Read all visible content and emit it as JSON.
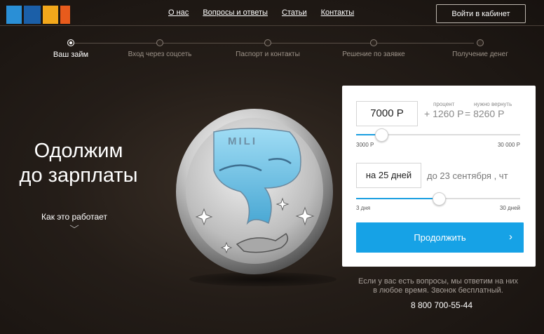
{
  "logo": {
    "text": "MILI",
    "colors": [
      "#2a8fd6",
      "#1b5fa8",
      "#f2a71b",
      "#e85b1c"
    ]
  },
  "nav": {
    "items": [
      "О нас",
      "Вопросы и ответы",
      "Статьи",
      "Контакты"
    ]
  },
  "login": {
    "label": "Войти   в кабинет"
  },
  "steps": [
    {
      "label": "Ваш займ",
      "active": true
    },
    {
      "label": "Вход  через  соцсеть",
      "active": false
    },
    {
      "label": "Паспорт  и контакты",
      "active": false
    },
    {
      "label": "Решение   по заявке",
      "active": false
    },
    {
      "label": "Получение   денег",
      "active": false
    }
  ],
  "hero": {
    "line1": "Одолжим",
    "line2": "до зарплаты"
  },
  "how_it_works": {
    "label": "Как это работает",
    "icon": "chevron-down-icon"
  },
  "coin": {
    "text": "MILI"
  },
  "calculator": {
    "amount": "7000  Р",
    "percent_label": "процент",
    "return_label": "нужно  вернуть",
    "percent_value": "+ 1260   Р",
    "return_value": "= 8260   Р",
    "amount_min": "3000  Р",
    "amount_max": "30 000  Р",
    "amount_fraction": 0.148,
    "days": "на 25 дней",
    "date_text": "до  23  сентября  , чт",
    "days_min": "3 дня",
    "days_max": "30 дней",
    "days_fraction": 0.5,
    "continue_label": "Продолжить",
    "accent": "#16a2e6"
  },
  "info": {
    "line1": "Если у вас есть вопросы, мы ответим на них",
    "line2": "в любое время. Звонок бесплатный."
  },
  "phone": "8 800 700-55-44"
}
